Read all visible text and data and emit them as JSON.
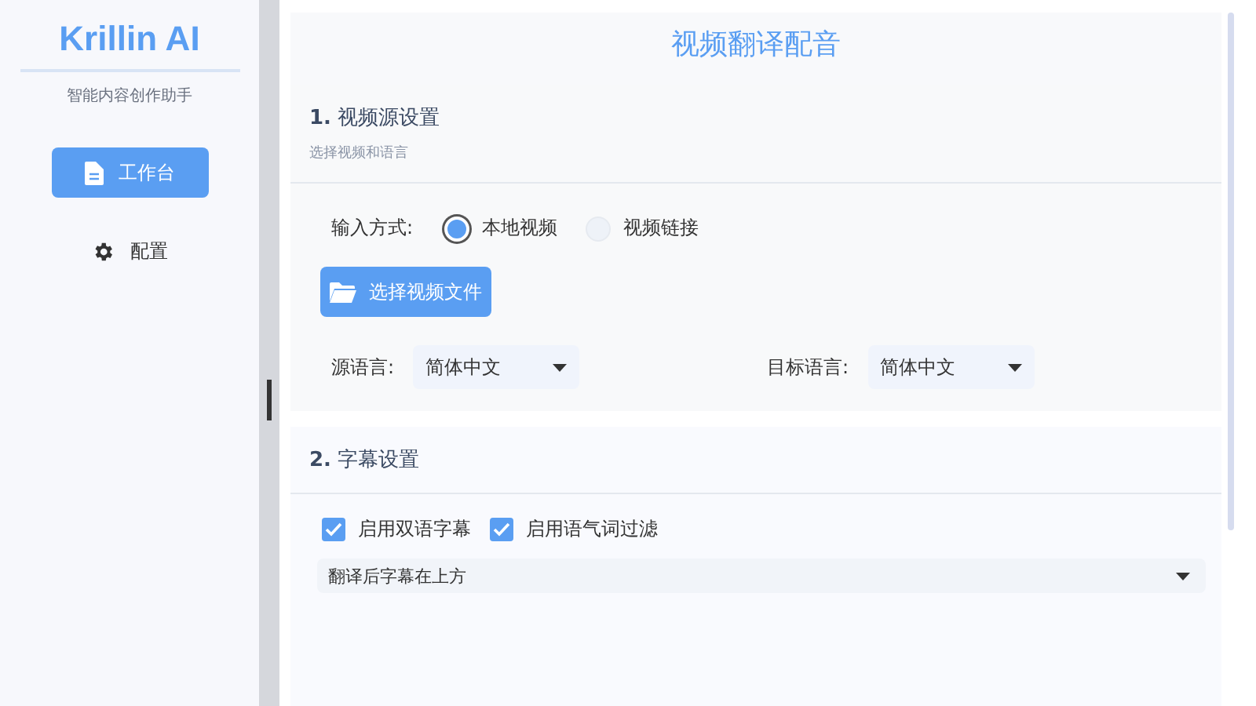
{
  "sidebar": {
    "logo": "Krillin AI",
    "subtitle": "智能内容创作助手",
    "nav": [
      {
        "label": "工作台",
        "kind": "document",
        "selected": true
      },
      {
        "label": "配置",
        "kind": "gear",
        "selected": false
      }
    ]
  },
  "main": {
    "title": "视频翻译配音",
    "source_section": {
      "heading": "**1.** 视频源设置",
      "subtitle": "选择视频和语言",
      "input_label": "输入方式:",
      "radios": [
        {
          "label": "本地视频",
          "selected": true
        },
        {
          "label": "视频链接",
          "selected": false
        }
      ],
      "file_button": "选择视频文件",
      "languages": [
        {
          "label": "源语言:",
          "value": "简体中文"
        },
        {
          "label": "目标语言:",
          "value": "简体中文"
        }
      ]
    },
    "subtitle_section": {
      "heading": "**2.** 字幕设置",
      "checkboxes": [
        {
          "label": "启用双语字幕",
          "checked": true
        },
        {
          "label": "启用语气词过滤",
          "checked": true
        }
      ],
      "position_select": "翻译后字幕在上方"
    }
  }
}
